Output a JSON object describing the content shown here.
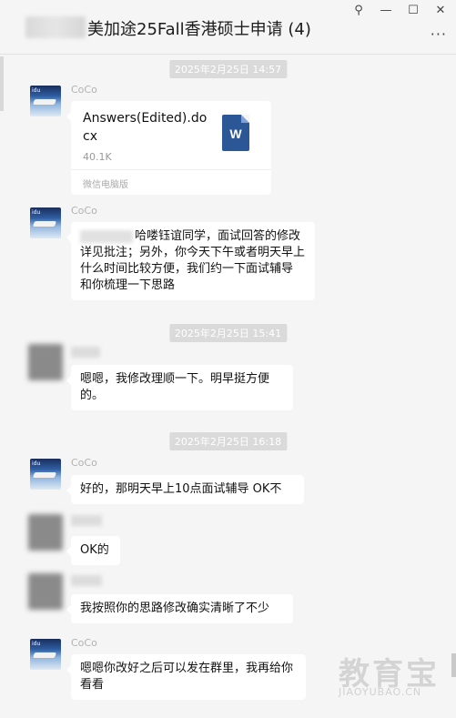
{
  "window": {
    "title": "美加途25Fall香港硕士申请 (4)",
    "pin_icon": "pin-icon",
    "controls": [
      "minimize-icon",
      "maximize-icon",
      "close-icon"
    ],
    "more_icon": "more-icon"
  },
  "messages": {
    "ts1": "2025年2月25日 14:57",
    "m1_name": "CoCo",
    "m1_file_name": "Answers(Edited).docx",
    "m1_file_size": "40.1K",
    "m1_file_source": "微信电脑版",
    "m2_name": "CoCo",
    "m2_text": "哈喽钰谊同学，面试回答的修改详见批注；另外，你今天下午或者明天早上什么时间比较方便，我们约一下面试辅导 和你梳理一下思路",
    "ts2": "2025年2月25日 15:41",
    "m3_text": "嗯嗯，我修改理顺一下。明早挺方便的。",
    "ts3": "2025年2月25日 16:18",
    "m4_name": "CoCo",
    "m4_text": "好的，那明天早上10点面试辅导 OK不",
    "m5_text": "OK的",
    "m6_text": "我按照你的思路修改确实清晰了不少",
    "m7_name": "CoCo",
    "m7_text": "嗯嗯你改好之后可以发在群里，我再给你看看"
  },
  "watermark": {
    "main": "教育宝",
    "sub": "JIAOYUBAO.CN"
  }
}
